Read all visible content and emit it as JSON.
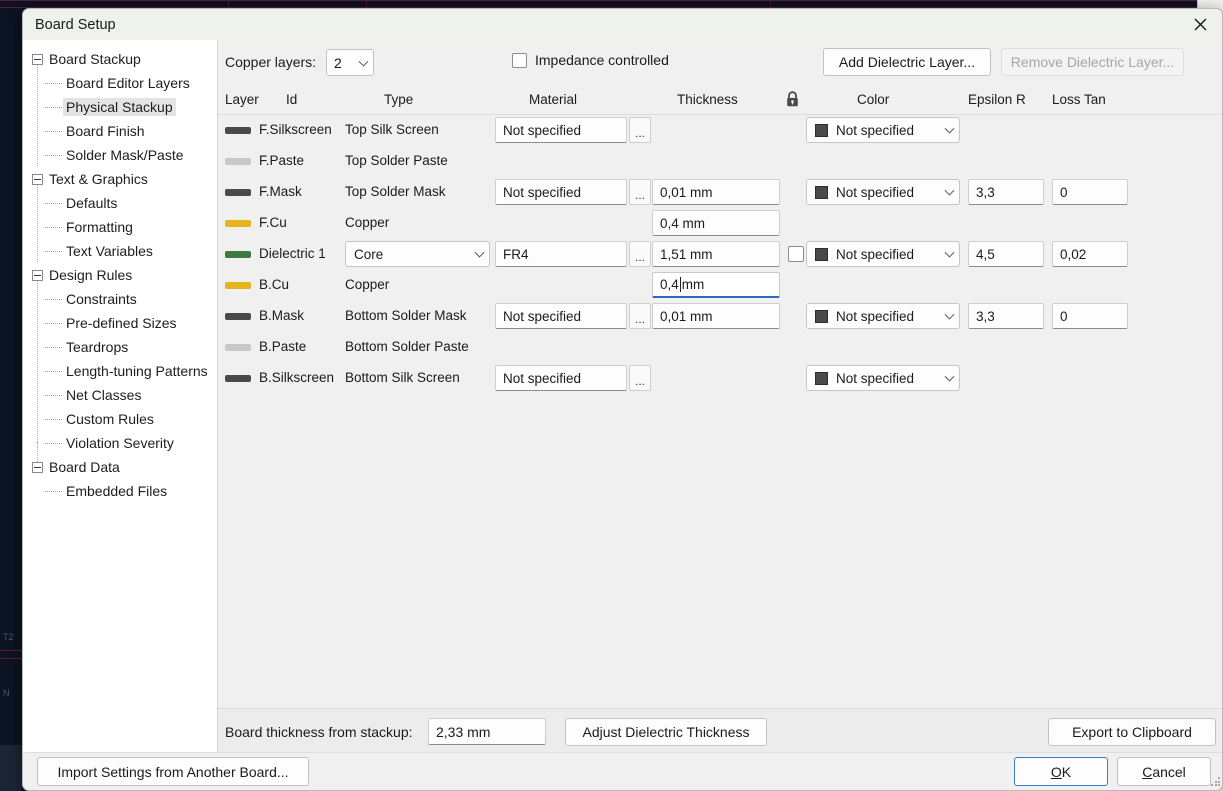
{
  "dialog": {
    "title": "Board Setup",
    "close_icon": "close-icon"
  },
  "sidebar": {
    "items": [
      {
        "label": "Board Stackup",
        "level": 0,
        "selected": false
      },
      {
        "label": "Board Editor Layers",
        "level": 1,
        "selected": false
      },
      {
        "label": "Physical Stackup",
        "level": 1,
        "selected": true
      },
      {
        "label": "Board Finish",
        "level": 1,
        "selected": false
      },
      {
        "label": "Solder Mask/Paste",
        "level": 1,
        "selected": false
      },
      {
        "label": "Text & Graphics",
        "level": 0,
        "selected": false
      },
      {
        "label": "Defaults",
        "level": 1,
        "selected": false
      },
      {
        "label": "Formatting",
        "level": 1,
        "selected": false
      },
      {
        "label": "Text Variables",
        "level": 1,
        "selected": false
      },
      {
        "label": "Design Rules",
        "level": 0,
        "selected": false
      },
      {
        "label": "Constraints",
        "level": 1,
        "selected": false
      },
      {
        "label": "Pre-defined Sizes",
        "level": 1,
        "selected": false
      },
      {
        "label": "Teardrops",
        "level": 1,
        "selected": false
      },
      {
        "label": "Length-tuning Patterns",
        "level": 1,
        "selected": false
      },
      {
        "label": "Net Classes",
        "level": 1,
        "selected": false
      },
      {
        "label": "Custom Rules",
        "level": 1,
        "selected": false
      },
      {
        "label": "Violation Severity",
        "level": 1,
        "selected": false
      },
      {
        "label": "Board Data",
        "level": 0,
        "selected": false
      },
      {
        "label": "Embedded Files",
        "level": 1,
        "selected": false
      }
    ]
  },
  "toolbar": {
    "copper_layers_label": "Copper layers:",
    "copper_layers_value": "2",
    "impedance_label": "Impedance controlled",
    "impedance_checked": false,
    "add_dielectric_label": "Add Dielectric Layer...",
    "remove_dielectric_label": "Remove Dielectric Layer...",
    "remove_dielectric_disabled": true
  },
  "grid": {
    "headers": {
      "layer": "Layer",
      "id": "Id",
      "type": "Type",
      "material": "Material",
      "thickness": "Thickness",
      "lock": "lock-icon",
      "color": "Color",
      "epsilon": "Epsilon R",
      "loss": "Loss Tan"
    },
    "rows": [
      {
        "swatch": "#4a4a4a",
        "id": "F.Silkscreen",
        "type": "Top Silk Screen",
        "type_is_combo": false,
        "material": "Not specified",
        "has_material": true,
        "thickness": "",
        "has_thickness": false,
        "has_lock": false,
        "color": "Not specified",
        "has_color": true,
        "color_chip": "#4a4a4a",
        "epsilon": "",
        "loss": "",
        "has_eps": false,
        "focused": false
      },
      {
        "swatch": "#c8c8c8",
        "id": "F.Paste",
        "type": "Top Solder Paste",
        "type_is_combo": false,
        "material": "",
        "has_material": false,
        "thickness": "",
        "has_thickness": false,
        "has_lock": false,
        "color": "",
        "has_color": false,
        "color_chip": "#4a4a4a",
        "epsilon": "",
        "loss": "",
        "has_eps": false,
        "focused": false
      },
      {
        "swatch": "#4a4a4a",
        "id": "F.Mask",
        "type": "Top Solder Mask",
        "type_is_combo": false,
        "material": "Not specified",
        "has_material": true,
        "thickness": "0,01 mm",
        "has_thickness": true,
        "has_lock": false,
        "color": "Not specified",
        "has_color": true,
        "color_chip": "#4a4a4a",
        "epsilon": "3,3",
        "loss": "0",
        "has_eps": true,
        "focused": false
      },
      {
        "swatch": "#e8b41e",
        "id": "F.Cu",
        "type": "Copper",
        "type_is_combo": false,
        "material": "",
        "has_material": false,
        "thickness": "0,4 mm",
        "has_thickness": true,
        "has_lock": false,
        "color": "",
        "has_color": false,
        "color_chip": "#4a4a4a",
        "epsilon": "",
        "loss": "",
        "has_eps": false,
        "focused": false
      },
      {
        "swatch": "#3d7a3d",
        "id": "Dielectric 1",
        "type": "Core",
        "type_is_combo": true,
        "material": "FR4",
        "has_material": true,
        "thickness": "1,51 mm",
        "has_thickness": true,
        "has_lock": true,
        "lock_checked": false,
        "color": "Not specified",
        "has_color": true,
        "color_chip": "#4a4a4a",
        "epsilon": "4,5",
        "loss": "0,02",
        "has_eps": true,
        "focused": false
      },
      {
        "swatch": "#e8b41e",
        "id": "B.Cu",
        "type": "Copper",
        "type_is_combo": false,
        "material": "",
        "has_material": false,
        "thickness": "0,4 mm",
        "thickness_before_caret": "0,4",
        "thickness_after_caret": " mm",
        "has_thickness": true,
        "has_lock": false,
        "color": "",
        "has_color": false,
        "color_chip": "#4a4a4a",
        "epsilon": "",
        "loss": "",
        "has_eps": false,
        "focused": true
      },
      {
        "swatch": "#4a4a4a",
        "id": "B.Mask",
        "type": "Bottom Solder Mask",
        "type_is_combo": false,
        "material": "Not specified",
        "has_material": true,
        "thickness": "0,01 mm",
        "has_thickness": true,
        "has_lock": false,
        "color": "Not specified",
        "has_color": true,
        "color_chip": "#4a4a4a",
        "epsilon": "3,3",
        "loss": "0",
        "has_eps": true,
        "focused": false
      },
      {
        "swatch": "#c8c8c8",
        "id": "B.Paste",
        "type": "Bottom Solder Paste",
        "type_is_combo": false,
        "material": "",
        "has_material": false,
        "thickness": "",
        "has_thickness": false,
        "has_lock": false,
        "color": "",
        "has_color": false,
        "color_chip": "#4a4a4a",
        "epsilon": "",
        "loss": "",
        "has_eps": false,
        "focused": false
      },
      {
        "swatch": "#4a4a4a",
        "id": "B.Silkscreen",
        "type": "Bottom Silk Screen",
        "type_is_combo": false,
        "material": "Not specified",
        "has_material": true,
        "thickness": "",
        "has_thickness": false,
        "has_lock": false,
        "color": "Not specified",
        "has_color": true,
        "color_chip": "#4a4a4a",
        "epsilon": "",
        "loss": "",
        "has_eps": false,
        "focused": false
      }
    ],
    "dots_label": "..."
  },
  "bottom": {
    "board_thickness_label": "Board thickness from stackup:",
    "board_thickness_value": "2,33 mm",
    "adjust_label": "Adjust Dielectric Thickness",
    "export_label": "Export to Clipboard"
  },
  "footer": {
    "import_label": "Import Settings from Another Board...",
    "ok_label": "OK",
    "ok_accel": "O",
    "cancel_label": "Cancel",
    "cancel_accel": "C"
  },
  "right_toolbar": {
    "icons": [
      "highlight-net-icon",
      "highlight-ratsnest-icon",
      "route-track-icon",
      "differential-pair-icon",
      "tune-length-icon",
      "via-icon",
      "zone-fill-icon",
      "hatched-zone-icon",
      "line-icon",
      "rectangle-icon",
      "circle-icon",
      "arc-icon",
      "polygon-icon",
      "footprint-icon",
      "dimension-icon",
      "text-icon",
      "table-icon",
      "measure-icon",
      "origin-icon"
    ]
  },
  "colors": {
    "accent": "#3a7bc8",
    "canvas_bg": "#0c1322",
    "dialog_bg": "#f0f0f0",
    "sidebar_bg": "#ffffff",
    "titlebar_bg": "#eef1ec"
  }
}
